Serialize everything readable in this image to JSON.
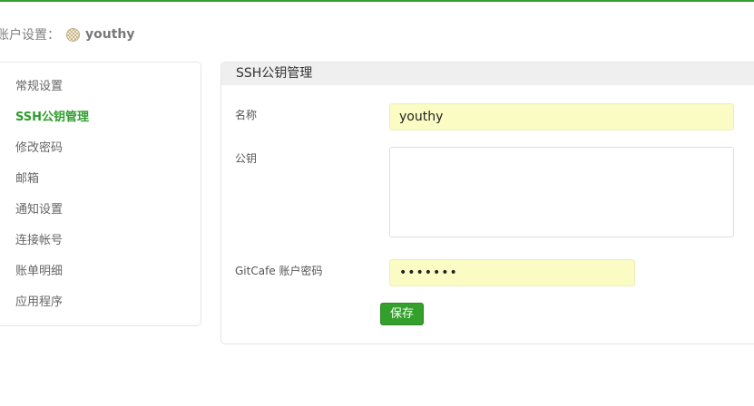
{
  "colors": {
    "accent": "#33a02c",
    "active_nav": "#2d9e2d",
    "autofill": "#fafcc4"
  },
  "account": {
    "label": "账户设置：",
    "username": "youthy",
    "avatar_icon": "avatar-icon"
  },
  "sidebar": {
    "items": [
      {
        "label": "常规设置",
        "active": false
      },
      {
        "label": "SSH公钥管理",
        "active": true
      },
      {
        "label": "修改密码",
        "active": false
      },
      {
        "label": "邮箱",
        "active": false
      },
      {
        "label": "通知设置",
        "active": false
      },
      {
        "label": "连接帐号",
        "active": false
      },
      {
        "label": "账单明细",
        "active": false
      },
      {
        "label": "应用程序",
        "active": false
      }
    ]
  },
  "panel": {
    "title": "SSH公钥管理",
    "fields": {
      "name": {
        "label": "名称",
        "value": "youthy"
      },
      "key": {
        "label": "公钥",
        "value": ""
      },
      "password": {
        "label": "GitCafe 账户密码",
        "value": "•••••••"
      }
    },
    "save_label": "保存"
  }
}
